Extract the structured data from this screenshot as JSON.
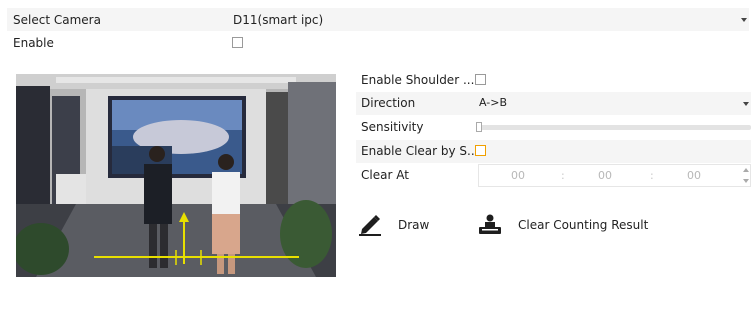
{
  "camera_row": {
    "label": "Select Camera",
    "value": "D11(smart ipc)"
  },
  "enable_row": {
    "label": "Enable",
    "checked": false
  },
  "settings": {
    "shoulder": {
      "label": "Enable Shoulder ...",
      "checked": false
    },
    "direction": {
      "label": "Direction",
      "value": "A->B"
    },
    "sensitivity": {
      "label": "Sensitivity",
      "level": 0
    },
    "clear_by_schedule": {
      "label": "Enable Clear by S...",
      "checked": false
    },
    "clear_at": {
      "label": "Clear At",
      "hour": "00",
      "minute": "00",
      "second": "00",
      "separator": ":"
    }
  },
  "actions": {
    "draw": {
      "label": "Draw",
      "icon": "pencil-icon"
    },
    "clear_result": {
      "label": "Clear Counting Result",
      "icon": "people-counter-icon"
    }
  },
  "colors": {
    "rule_line": "#e8e000",
    "checkbox_highlight": "#f0a000"
  }
}
